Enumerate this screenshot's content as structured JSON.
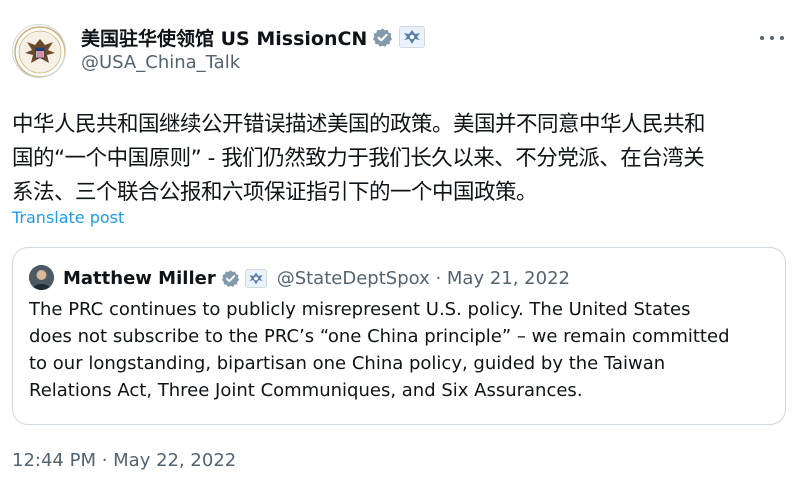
{
  "author": {
    "display_name": "美国驻华使领馆 US MissionCN",
    "handle": "@USA_China_Talk",
    "verified_badge_icon": "verified-badge-icon",
    "government_badge_icon": "government-seal-icon"
  },
  "more_icon": "more-horizontal-icon",
  "tweet": {
    "lines": [
      "中华人民共和国继续公开错误描述美国的政策。美国并不同意中华人民共和",
      "国的“一个中国原则” - 我们仍然致力于我们长久以来、不分党派、在台湾关",
      "系法、三个联合公报和六项保证指引下的一个中国政策。"
    ],
    "translate_label": "Translate post"
  },
  "quote": {
    "name": "Matthew Miller",
    "meta": "@StateDeptSpox · May 21, 2022",
    "lines": [
      "The PRC continues to publicly misrepresent U.S. policy. The United States",
      "does not subscribe to the PRC’s “one China principle” – we remain committed",
      "to our longstanding, bipartisan one China policy, guided by the Taiwan",
      "Relations Act, Three Joint Communiques, and Six Assurances."
    ]
  },
  "timestamp": "12:44 PM · May 22, 2022",
  "colors": {
    "link": "#1d9bf0",
    "secondary_text": "#536471",
    "border": "#cfd9de"
  }
}
